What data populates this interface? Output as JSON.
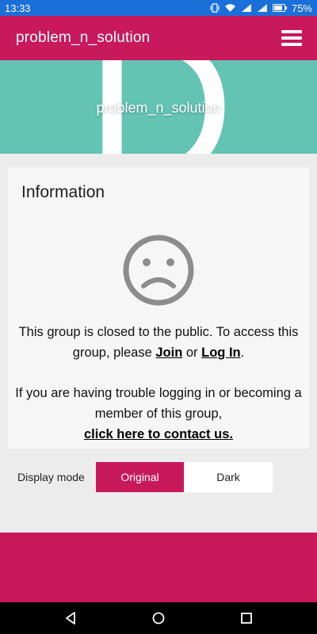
{
  "status_bar": {
    "time": "13:33",
    "battery": "75%",
    "icons": [
      "vibrate-icon",
      "wifi-icon",
      "signal-icon",
      "signal-icon",
      "battery-icon"
    ]
  },
  "app_bar": {
    "title": "problem_n_solution",
    "menu_icon": "hamburger-menu-icon",
    "color": "#c8195a"
  },
  "banner": {
    "letter": "D",
    "title": "problem_n_solution",
    "color": "#64c4b3"
  },
  "info_card": {
    "title": "Information",
    "icon": "sad-face-icon",
    "message_1_prefix": "This group is closed to the public. To access this group, please ",
    "join_link": "Join",
    "or_text": " or ",
    "login_link": "Log In",
    "period": ".",
    "message_2": "If you are having trouble logging in or becoming a member of this group,",
    "contact_link": "click here to contact us."
  },
  "display_mode": {
    "label": "Display mode",
    "options": [
      "Original",
      "Dark"
    ],
    "selected": "Original"
  },
  "nav_bar": {
    "icons": [
      "back-icon",
      "home-icon",
      "recents-icon"
    ]
  }
}
